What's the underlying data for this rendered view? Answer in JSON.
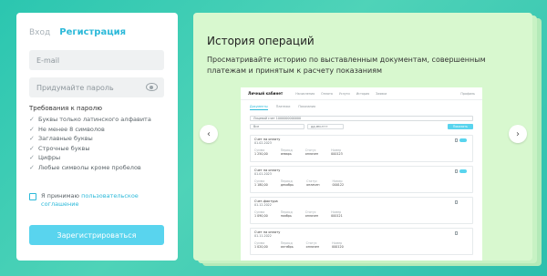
{
  "auth": {
    "tab_login": "Вход",
    "tab_register": "Регистрация",
    "email_placeholder": "E-mail",
    "password_placeholder": "Придумайте пароль",
    "requirements_title": "Требования к паролю",
    "requirements": [
      "Буквы только латинского алфавита",
      "Не менее 8 символов",
      "Заглавные буквы",
      "Строчные буквы",
      "Цифры",
      "Любые символы кроме пробелов"
    ],
    "agree_text": "Я принимаю",
    "agree_link": "пользовательское соглашение",
    "register_button": "Зарегистрироваться"
  },
  "promo": {
    "title": "История операций",
    "description": "Просматривайте историю по выставленным документам, совершенным платежам и принятым к расчету показаниям",
    "prev_icon": "chevron-left-icon",
    "next_icon": "chevron-right-icon"
  },
  "mini": {
    "logo": "Личный кабинет",
    "nav": [
      "Начисления",
      "Оплата",
      "Услуги",
      "История",
      "Заявки"
    ],
    "user": "Профиль",
    "tabs": [
      "Документы",
      "Платежи",
      "Показания"
    ],
    "account_filter": "Лицевой счет 1000000000000",
    "period_filter": "Все",
    "date_filter": "дд.мм.гггг",
    "show_button": "Показать",
    "cards": [
      {
        "title": "Счет на оплату",
        "date": "01.02.2023",
        "cols": [
          [
            "Сумма",
            "1 250,00"
          ],
          [
            "Период",
            "январь"
          ],
          [
            "Статус",
            "оплачен"
          ],
          [
            "Номер",
            "000123"
          ]
        ]
      },
      {
        "title": "Счет на оплату",
        "date": "01.01.2023",
        "cols": [
          [
            "Сумма",
            "1 180,00"
          ],
          [
            "Период",
            "декабрь"
          ],
          [
            "Статус",
            "оплачен"
          ],
          [
            "Номер",
            "000122"
          ]
        ]
      },
      {
        "title": "Счет-фактура",
        "date": "01.12.2022",
        "cols": [
          [
            "Сумма",
            "1 090,00"
          ],
          [
            "Период",
            "ноябрь"
          ],
          [
            "Статус",
            "оплачен"
          ],
          [
            "Номер",
            "000121"
          ]
        ]
      },
      {
        "title": "Счет на оплату",
        "date": "01.11.2022",
        "cols": [
          [
            "Сумма",
            "1 020,00"
          ],
          [
            "Период",
            "октябрь"
          ],
          [
            "Статус",
            "оплачен"
          ],
          [
            "Номер",
            "000120"
          ]
        ]
      }
    ]
  },
  "colors": {
    "accent": "#2cb9d9",
    "button": "#59d4ee",
    "background": "#2bc6b0",
    "promo_card": "#d8f8cf"
  }
}
